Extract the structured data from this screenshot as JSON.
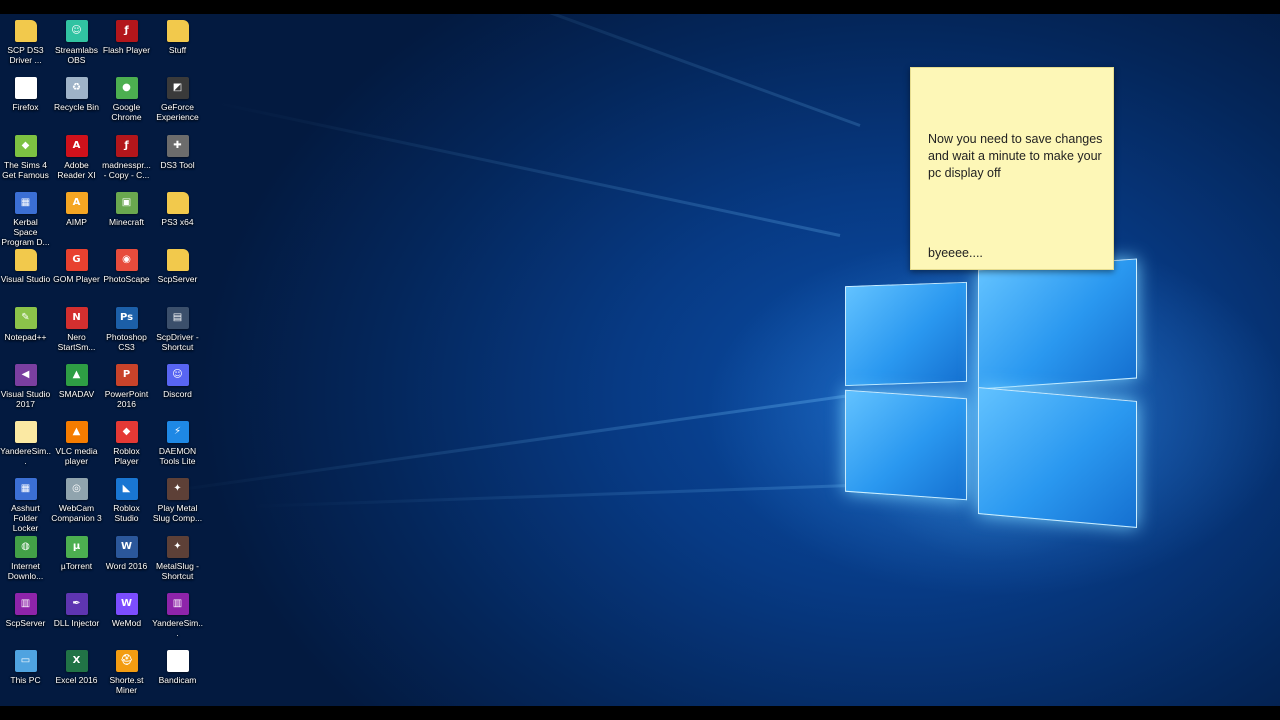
{
  "sticky_note": {
    "message": "Now you need to save changes and wait a minute to make your pc display off",
    "signature": "byeeee...."
  },
  "desktop_icons": [
    {
      "label": "SCP DS3 Driver ...",
      "icon": "folder-icon",
      "color": "#f2c94c",
      "glyph": ""
    },
    {
      "label": "Streamlabs OBS",
      "icon": "streamlabs-icon",
      "color": "#31c3a2",
      "glyph": "☺"
    },
    {
      "label": "Flash Player",
      "icon": "flash-player-icon",
      "color": "#b3161b",
      "glyph": "ƒ"
    },
    {
      "label": "Stuff",
      "icon": "folder-icon",
      "color": "#f2c94c",
      "glyph": ""
    },
    {
      "label": "Firefox",
      "icon": "document-icon",
      "color": "#ffffff",
      "glyph": ""
    },
    {
      "label": "Recycle Bin",
      "icon": "recycle-bin-icon",
      "color": "#9fb3c8",
      "glyph": "♻"
    },
    {
      "label": "Google Chrome",
      "icon": "chrome-icon",
      "color": "#4caf50",
      "glyph": "●"
    },
    {
      "label": "GeForce Experience",
      "icon": "geforce-icon",
      "color": "#3a3a3a",
      "glyph": "◩"
    },
    {
      "label": "The Sims 4 Get Famous",
      "icon": "sims-icon",
      "color": "#7dc242",
      "glyph": "◆"
    },
    {
      "label": "Adobe Reader XI",
      "icon": "adobe-reader-icon",
      "color": "#d0111b",
      "glyph": "A"
    },
    {
      "label": "madnesspr... - Copy - C...",
      "icon": "flash-player-icon",
      "color": "#b3161b",
      "glyph": "ƒ"
    },
    {
      "label": "DS3 Tool",
      "icon": "gamepad-icon",
      "color": "#6c6c6c",
      "glyph": "✚"
    },
    {
      "label": "Kerbal Space Program D...",
      "icon": "app-shortcut-icon",
      "color": "#3b6fd4",
      "glyph": "▦"
    },
    {
      "label": "AIMP",
      "icon": "aimp-icon",
      "color": "#f5a623",
      "glyph": "A"
    },
    {
      "label": "Minecraft",
      "icon": "minecraft-icon",
      "color": "#6aa84f",
      "glyph": "▣"
    },
    {
      "label": "PS3 x64",
      "icon": "folder-icon",
      "color": "#f2c94c",
      "glyph": ""
    },
    {
      "label": "Visual Studio",
      "icon": "folder-icon",
      "color": "#f2c94c",
      "glyph": ""
    },
    {
      "label": "GOM Player",
      "icon": "gom-player-icon",
      "color": "#e8412f",
      "glyph": "G"
    },
    {
      "label": "PhotoScape",
      "icon": "photoscape-icon",
      "color": "#e74c3c",
      "glyph": "◉"
    },
    {
      "label": "ScpServer",
      "icon": "folder-icon",
      "color": "#f2c94c",
      "glyph": ""
    },
    {
      "label": "Notepad++",
      "icon": "notepad-plus-icon",
      "color": "#8bc34a",
      "glyph": "✎"
    },
    {
      "label": "Nero StartSm...",
      "icon": "nero-icon",
      "color": "#d32f2f",
      "glyph": "N"
    },
    {
      "label": "Photoshop CS3",
      "icon": "photoshop-icon",
      "color": "#1c5fa8",
      "glyph": "Ps"
    },
    {
      "label": "ScpDriver - Shortcut",
      "icon": "app-shortcut-icon",
      "color": "#3b4f6b",
      "glyph": "▤"
    },
    {
      "label": "Visual Studio 2017",
      "icon": "visual-studio-icon",
      "color": "#7b3fa0",
      "glyph": "◀"
    },
    {
      "label": "SMADAV",
      "icon": "smadav-icon",
      "color": "#2e9e44",
      "glyph": "▲"
    },
    {
      "label": "PowerPoint 2016",
      "icon": "powerpoint-icon",
      "color": "#c9432a",
      "glyph": "P"
    },
    {
      "label": "Discord",
      "icon": "discord-icon",
      "color": "#5865f2",
      "glyph": "☺"
    },
    {
      "label": "YandereSim...",
      "icon": "document-icon",
      "color": "#fbe9a3",
      "glyph": ""
    },
    {
      "label": "VLC media player",
      "icon": "vlc-icon",
      "color": "#f57c00",
      "glyph": "▲"
    },
    {
      "label": "Roblox Player",
      "icon": "roblox-icon",
      "color": "#e53935",
      "glyph": "◆"
    },
    {
      "label": "DAEMON Tools Lite",
      "icon": "daemon-tools-icon",
      "color": "#1e88e5",
      "glyph": "⚡"
    },
    {
      "label": "Asshurt Folder Locker",
      "icon": "app-shortcut-icon",
      "color": "#3b6fd4",
      "glyph": "▦"
    },
    {
      "label": "WebCam Companion 3",
      "icon": "webcam-icon",
      "color": "#90a4ae",
      "glyph": "◎"
    },
    {
      "label": "Roblox Studio",
      "icon": "roblox-studio-icon",
      "color": "#1976d2",
      "glyph": "◣"
    },
    {
      "label": "Play Metal Slug Comp...",
      "icon": "metal-slug-icon",
      "color": "#5d4037",
      "glyph": "✦"
    },
    {
      "label": "Internet Downlo...",
      "icon": "internet-download-icon",
      "color": "#43a047",
      "glyph": "◍"
    },
    {
      "label": "µTorrent",
      "icon": "utorrent-icon",
      "color": "#4caf50",
      "glyph": "µ"
    },
    {
      "label": "Word 2016",
      "icon": "word-icon",
      "color": "#2b579a",
      "glyph": "W"
    },
    {
      "label": "MetalSlug - Shortcut",
      "icon": "metal-slug-icon",
      "color": "#5d4037",
      "glyph": "✦"
    },
    {
      "label": "ScpServer",
      "icon": "winrar-icon",
      "color": "#8e24aa",
      "glyph": "▥"
    },
    {
      "label": "DLL Injector",
      "icon": "dll-injector-icon",
      "color": "#5e35b1",
      "glyph": "✒"
    },
    {
      "label": "WeMod",
      "icon": "wemod-icon",
      "color": "#7c4dff",
      "glyph": "W"
    },
    {
      "label": "YandereSim...",
      "icon": "winrar-icon",
      "color": "#8e24aa",
      "glyph": "▥"
    },
    {
      "label": "This PC",
      "icon": "this-pc-icon",
      "color": "#4fa3e0",
      "glyph": "▭"
    },
    {
      "label": "Excel 2016",
      "icon": "excel-icon",
      "color": "#217346",
      "glyph": "X"
    },
    {
      "label": "Shorte.st Miner",
      "icon": "miner-icon",
      "color": "#f39c12",
      "glyph": "⛑"
    },
    {
      "label": "Bandicam",
      "icon": "document-icon",
      "color": "#ffffff",
      "glyph": ""
    }
  ]
}
